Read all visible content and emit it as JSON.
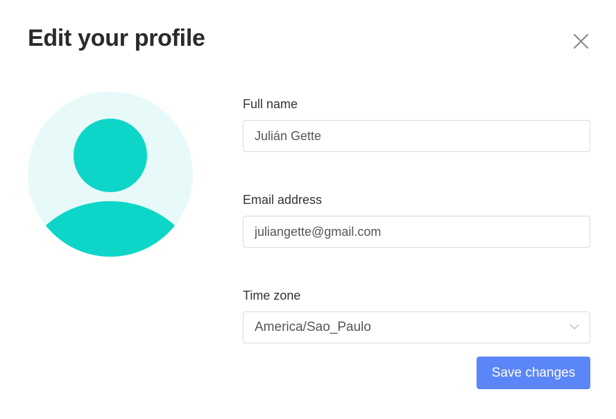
{
  "dialog": {
    "title": "Edit your profile",
    "close_icon": "close-icon"
  },
  "avatar": {
    "icon": "user-avatar-icon",
    "colors": {
      "background": "#e8f9f9",
      "figure": "#0dd6c8"
    }
  },
  "form": {
    "full_name": {
      "label": "Full name",
      "value": "Julián Gette"
    },
    "email": {
      "label": "Email address",
      "value": "juliangette@gmail.com"
    },
    "time_zone": {
      "label": "Time zone",
      "selected": "America/Sao_Paulo",
      "icon": "chevron-down-icon"
    }
  },
  "actions": {
    "save_label": "Save changes",
    "save_color": "#5b86f7"
  }
}
